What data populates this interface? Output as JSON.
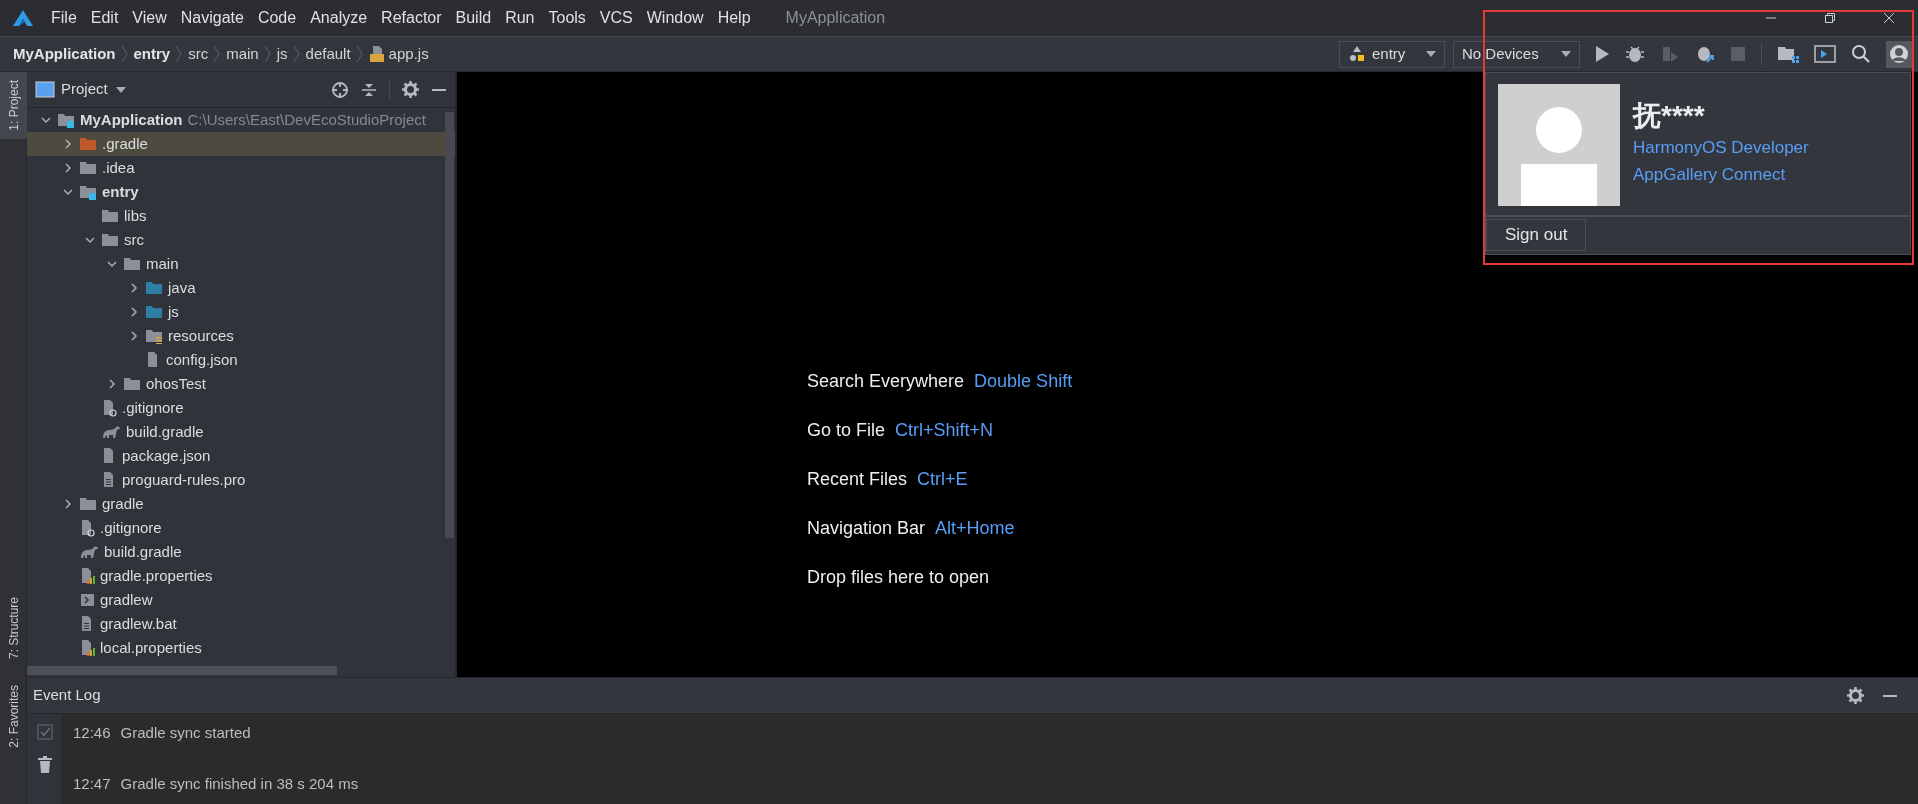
{
  "menu_bar": {
    "items": [
      "File",
      "Edit",
      "View",
      "Navigate",
      "Code",
      "Analyze",
      "Refactor",
      "Build",
      "Run",
      "Tools",
      "VCS",
      "Window",
      "Help"
    ],
    "title": "MyApplication"
  },
  "breadcrumbs": [
    {
      "label": "MyApplication",
      "bold": true
    },
    {
      "label": "entry",
      "bold": true
    },
    {
      "label": "src",
      "bold": false
    },
    {
      "label": "main",
      "bold": false
    },
    {
      "label": "js",
      "bold": false
    },
    {
      "label": "default",
      "bold": false
    },
    {
      "label": "app.js",
      "bold": false,
      "file": true
    }
  ],
  "toolbar": {
    "module_dropdown": "entry",
    "device_dropdown": "No Devices",
    "account_selected": true
  },
  "side_tabs": [
    {
      "label": "1: Project",
      "selected": true
    },
    {
      "label": "7: Structure",
      "selected": false
    },
    {
      "label": "2: Favorites",
      "selected": false
    }
  ],
  "project_panel": {
    "title": "Project",
    "tree": [
      {
        "label": "MyApplication",
        "kind": "module",
        "path": "C:\\Users\\East\\DevEcoStudioProject",
        "expanded": true,
        "selected": false,
        "children": [
          {
            "label": ".gradle",
            "kind": "excluded",
            "expanded": false,
            "selected": true
          },
          {
            "label": ".idea",
            "kind": "folder",
            "expanded": false,
            "selected": false
          },
          {
            "label": "entry",
            "kind": "module",
            "expanded": true,
            "selected": false,
            "children": [
              {
                "label": "libs",
                "kind": "folder",
                "selected": false
              },
              {
                "label": "src",
                "kind": "folder",
                "expanded": true,
                "selected": false,
                "children": [
                  {
                    "label": "main",
                    "kind": "folder",
                    "expanded": true,
                    "selected": false,
                    "children": [
                      {
                        "label": "java",
                        "kind": "source",
                        "expanded": false,
                        "selected": false
                      },
                      {
                        "label": "js",
                        "kind": "source",
                        "expanded": false,
                        "selected": false
                      },
                      {
                        "label": "resources",
                        "kind": "resources",
                        "expanded": false,
                        "selected": false
                      },
                      {
                        "label": "config.json",
                        "kind": "json",
                        "selected": false
                      }
                    ]
                  },
                  {
                    "label": "ohosTest",
                    "kind": "folder",
                    "expanded": false,
                    "selected": false
                  }
                ]
              },
              {
                "label": ".gitignore",
                "kind": "ignore",
                "selected": false
              },
              {
                "label": "build.gradle",
                "kind": "gradle",
                "selected": false
              },
              {
                "label": "package.json",
                "kind": "json",
                "selected": false
              },
              {
                "label": "proguard-rules.pro",
                "kind": "text",
                "selected": false
              }
            ]
          },
          {
            "label": "gradle",
            "kind": "folder",
            "expanded": false,
            "selected": false
          },
          {
            "label": ".gitignore",
            "kind": "ignore",
            "selected": false
          },
          {
            "label": "build.gradle",
            "kind": "gradle",
            "selected": false
          },
          {
            "label": "gradle.properties",
            "kind": "properties",
            "selected": false
          },
          {
            "label": "gradlew",
            "kind": "script",
            "selected": false
          },
          {
            "label": "gradlew.bat",
            "kind": "text",
            "selected": false
          },
          {
            "label": "local.properties",
            "kind": "properties",
            "selected": false
          }
        ]
      }
    ]
  },
  "editor": {
    "hints": [
      {
        "label": "Search Everywhere",
        "shortcut": "Double Shift"
      },
      {
        "label": "Go to File",
        "shortcut": "Ctrl+Shift+N"
      },
      {
        "label": "Recent Files",
        "shortcut": "Ctrl+E"
      },
      {
        "label": "Navigation Bar",
        "shortcut": "Alt+Home"
      }
    ],
    "drop_hint": "Drop files here to open"
  },
  "account_popup": {
    "name": "抚****",
    "links": [
      "HarmonyOS Developer",
      "AppGallery Connect"
    ],
    "button": "Sign out"
  },
  "event_log": {
    "title": "Event Log",
    "entries": [
      {
        "time": "12:46",
        "message": "Gradle sync started"
      },
      {
        "time": "12:47",
        "message": "Gradle sync finished in 38 s 204 ms"
      }
    ]
  }
}
